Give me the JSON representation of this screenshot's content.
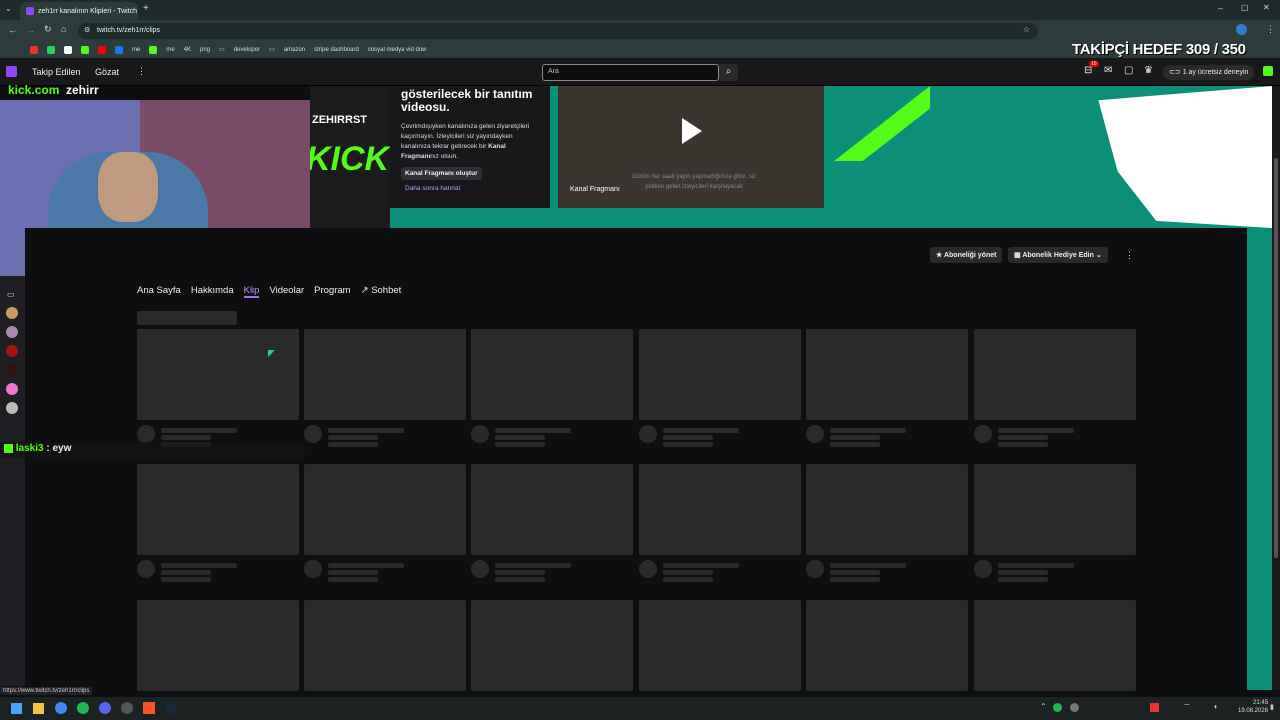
{
  "browser": {
    "tab_title": "zeh1rr kanalının Klipleri - Twitch",
    "url": "twitch.tv/zeh1rr/clips",
    "status_url": "https://www.twitch.tv/zeh1rr/clips",
    "bookmarks": [
      "me",
      "me",
      "4K",
      "png",
      "developer",
      "amazon",
      "stripe dashboard",
      "sosyal medya vid dow"
    ]
  },
  "overlay": {
    "follower_goal": "TAKİPÇİ HEDEF 309 / 350",
    "kick_domain": "kick.com",
    "kick_user": "zehirr",
    "chat_user": "laski3",
    "chat_sep": ":",
    "chat_msg": "eyw"
  },
  "twitch": {
    "nav_following": "Takip Edilen",
    "nav_browse": "Gözat",
    "search_placeholder": "Ara",
    "notif_count": "10",
    "prime_label": "1 ay ücretsiz deneyin"
  },
  "banner": {
    "trailer_title": "gösterilecek bir tanıtım videosu.",
    "trailer_desc_1": "Çevrimdışıyken kanalınıza gelen ziyaretçileri kaçırmayın. İzleyicileri siz yayındayken kanalınıza tekrar getirecek bir",
    "trailer_desc_bold": "Kanal Fragmanı",
    "trailer_desc_2": "nız olsun.",
    "create_trailer": "Kanal Fragmanı oluştur",
    "remind_later": "Daha sonra hatırlat",
    "preview_label": "Kanal Fragmanı",
    "preview_caption": "Günün her saati yayın yapmadığınıza göre, siz yokken gelen izleyicileri karşılayacak",
    "brand_text": "ZEHIRRST",
    "kick_art": "KICK"
  },
  "channel": {
    "manage_sub": "Aboneliği yönet",
    "gift_sub": "Abonelik Hediye Edin",
    "tabs": [
      {
        "label": "Ana Sayfa"
      },
      {
        "label": "Hakkımda"
      },
      {
        "label": "Klip"
      },
      {
        "label": "Videolar"
      },
      {
        "label": "Program"
      },
      {
        "label": "Sohbet"
      }
    ]
  },
  "clock": {
    "time": "21:45",
    "date": "19.08.2026"
  },
  "colors": {
    "twitch_purple": "#9147ff",
    "accent_teal": "#0c8f79",
    "kick_green": "#53fc18"
  }
}
